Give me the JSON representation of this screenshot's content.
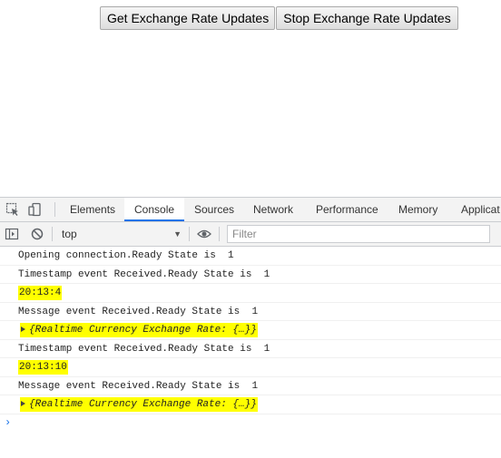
{
  "page": {
    "buttons": {
      "get_updates": "Get Exchange Rate Updates",
      "stop_updates": "Stop Exchange Rate Updates"
    }
  },
  "devtools": {
    "tabs": [
      "Elements",
      "Console",
      "Sources",
      "Network",
      "Performance",
      "Memory",
      "Applicat"
    ],
    "active_tab": "Console",
    "toolbar": {
      "context": "top",
      "filter_placeholder": "Filter"
    },
    "console": {
      "messages": [
        "Opening connection.Ready State is  1",
        "Timestamp event Received.Ready State is  1",
        "20:13:4",
        "Message event Received.Ready State is  1",
        "{Realtime Currency Exchange Rate: {…}}",
        "Timestamp event Received.Ready State is  1",
        "20:13:10",
        "Message event Received.Ready State is  1",
        "{Realtime Currency Exchange Rate: {…}}"
      ],
      "prompt_glyph": "›"
    }
  },
  "colors": {
    "highlight": "#ffff00",
    "accent": "#1a73e8",
    "panel_bg": "#f3f3f3"
  }
}
